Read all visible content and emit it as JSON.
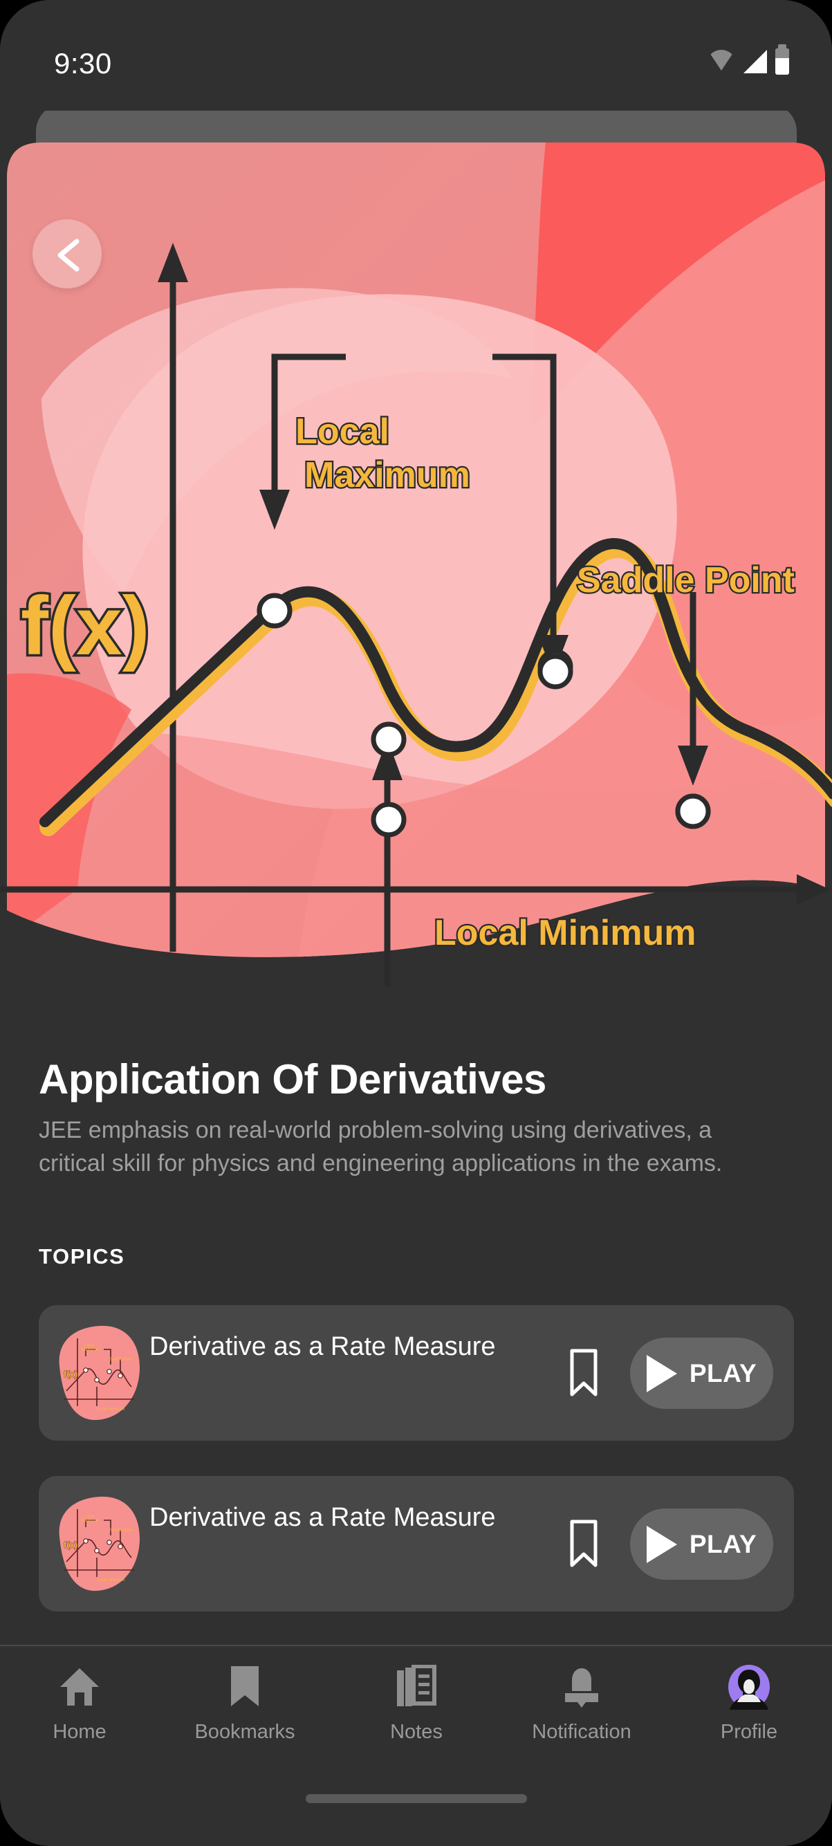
{
  "statusbar": {
    "time": "9:30",
    "icons": [
      "wifi-icon",
      "signal-icon",
      "battery-icon"
    ]
  },
  "hero": {
    "back_icon": "chevron-left-icon",
    "colors": {
      "bg_deep": "#f05a5a",
      "bg_mid": "#f08787",
      "bg_light": "#f9a8ab",
      "bg_pale": "#fbc0c3",
      "accent_yellow": "#f5b83d",
      "ink": "#2b2b2b"
    },
    "chart_data": {
      "type": "line",
      "title": "f(x)",
      "axis_label": "f(x)",
      "xlabel": "",
      "ylabel": "",
      "grid": false,
      "legend": false,
      "annotations": [
        {
          "label": "Local Maximum",
          "target_point_index": 0
        },
        {
          "label": "Local Minimum",
          "target_point_index": 1
        },
        {
          "label": "Saddle Point",
          "target_point_index": 3
        }
      ],
      "marked_points": [
        {
          "name": "Local Maximum",
          "x": 1.8,
          "y": 3.0
        },
        {
          "name": "Local Minimum",
          "x": 3.4,
          "y": 1.9
        },
        {
          "name": "Local Maximum 2",
          "x": 5.9,
          "y": 4.1
        },
        {
          "name": "Saddle Point",
          "x": 8.1,
          "y": 2.05
        }
      ],
      "x": [
        0.2,
        1.8,
        3.4,
        5.9,
        8.1,
        10.0
      ],
      "y": [
        0.55,
        3.0,
        1.9,
        4.1,
        2.05,
        1.1
      ],
      "xlim": [
        0,
        10
      ],
      "ylim": [
        0,
        5
      ]
    }
  },
  "main": {
    "title": "Application Of Derivatives",
    "description": "JEE emphasis on real-world problem-solving using derivatives, a critical skill for physics and engineering applications in the exams.",
    "topics_label": "TOPICS",
    "topics": [
      {
        "title": "Derivative as a Rate Measure",
        "thumbnail": "derivatives-chart-thumbnail",
        "bookmark_icon": "bookmark-icon",
        "play_label": "PLAY",
        "play_icon": "play-icon"
      },
      {
        "title": "Derivative as a Rate Measure",
        "thumbnail": "derivatives-chart-thumbnail",
        "bookmark_icon": "bookmark-icon",
        "play_label": "PLAY",
        "play_icon": "play-icon"
      }
    ]
  },
  "navbar": {
    "items": [
      {
        "label": "Home",
        "icon": "home-icon",
        "active": false
      },
      {
        "label": "Bookmarks",
        "icon": "bookmark-icon",
        "active": false
      },
      {
        "label": "Notes",
        "icon": "notes-icon",
        "active": false
      },
      {
        "label": "Notification",
        "icon": "bell-icon",
        "active": false
      },
      {
        "label": "Profile",
        "icon": "avatar-icon",
        "active": true
      }
    ],
    "active_color": "#9d7cf0"
  }
}
